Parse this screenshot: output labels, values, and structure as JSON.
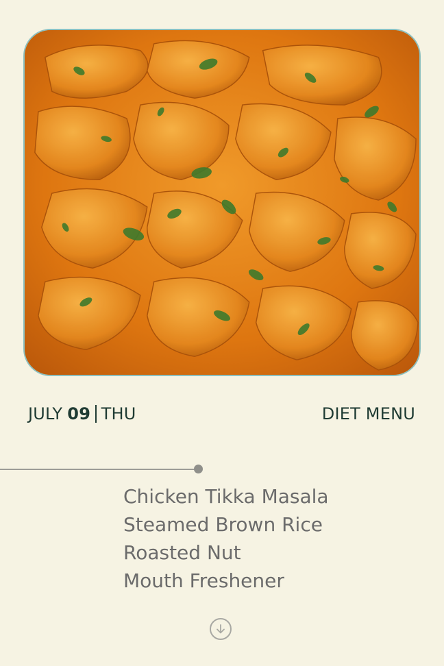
{
  "hero": {
    "image": "chicken-tikka-masala-photo"
  },
  "date": {
    "month": "JULY",
    "day": "09",
    "weekday": "THU"
  },
  "header": {
    "title": "DIET MENU"
  },
  "menu": {
    "items": [
      "Chicken Tikka Masala",
      "Steamed Brown Rice",
      "Roasted Nut",
      "Mouth Freshener"
    ]
  },
  "icons": {
    "scroll_down": "arrow-down-circle-icon"
  },
  "colors": {
    "background": "#f6f3e3",
    "text_dark": "#1f3b33",
    "text_muted": "#6b6b6b",
    "hero_border": "#8cc0c0"
  }
}
